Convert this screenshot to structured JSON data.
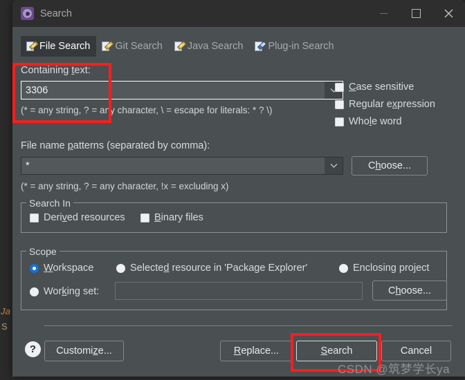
{
  "window": {
    "title": "Search",
    "icon": "gear-icon",
    "controls": {
      "minimize": "minimize-icon",
      "maximize": "maximize-icon",
      "close": "close-icon"
    }
  },
  "background": {
    "fragment_1": "Ja",
    "fragment_2": "S"
  },
  "tabs": [
    {
      "label": "File Search",
      "icon": "page-pencil-icon",
      "active": true
    },
    {
      "label": "Git Search",
      "icon": "page-pencil-icon",
      "active": false
    },
    {
      "label": "Java Search",
      "icon": "page-pencil-icon",
      "active": false
    },
    {
      "label": "Plug-in Search",
      "icon": "plug-pencil-icon",
      "active": false
    }
  ],
  "containing_text": {
    "label": "Containing text:",
    "value": "3306",
    "placeholder": "",
    "dropdown_icon": "chevron-down-icon",
    "hint": "(* = any string, ? = any character, \\ = escape for literals: * ? \\)"
  },
  "options": [
    {
      "label": "Case sensitive",
      "checked": false
    },
    {
      "label": "Regular expression",
      "checked": false
    },
    {
      "label": "Whole word",
      "checked": false
    }
  ],
  "file_patterns": {
    "label": "File name patterns (separated by comma):",
    "value": "*",
    "placeholder": "",
    "dropdown_icon": "chevron-down-icon",
    "choose_label": "Choose...",
    "hint": "(* = any string, ? = any character, !x = excluding x)"
  },
  "search_in": {
    "title": "Search In",
    "options": [
      {
        "label": "Derived resources",
        "checked": false
      },
      {
        "label": "Binary files",
        "checked": false
      }
    ]
  },
  "scope": {
    "title": "Scope",
    "radios": [
      {
        "label": "Workspace",
        "selected": true
      },
      {
        "label": "Selected resource in 'Package Explorer'",
        "selected": false
      },
      {
        "label": "Enclosing project",
        "selected": false
      },
      {
        "label": "Working set:",
        "selected": false
      }
    ],
    "working_set_value": "",
    "working_set_placeholder": "",
    "choose_label": "Choose..."
  },
  "footer": {
    "help_icon": "question-mark-icon",
    "help_label": "?",
    "customize_label": "Customize...",
    "replace_label": "Replace...",
    "search_label": "Search",
    "cancel_label": "Cancel"
  },
  "watermark": "CSDN @筑梦学长ya",
  "colors": {
    "dialog_bg": "#4a4f51",
    "titlebar_bg": "#2e2e2e",
    "active_tab_bg": "#35393b",
    "accent_radio": "#1573d4",
    "annotation_red": "#f61e1e",
    "text": "#d9dcdd"
  }
}
